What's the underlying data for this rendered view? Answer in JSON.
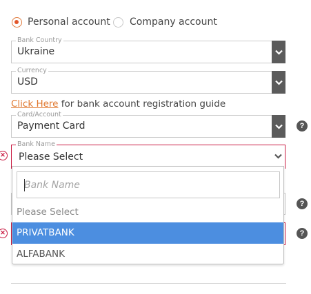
{
  "account_type": {
    "options": [
      {
        "label": "Personal account",
        "checked": true
      },
      {
        "label": "Company account",
        "checked": false
      }
    ]
  },
  "bank_country": {
    "label": "Bank Country",
    "value": "Ukraine"
  },
  "currency": {
    "label": "Currency",
    "value": "USD"
  },
  "guide": {
    "link_text": "Click Here",
    "rest": " for bank account registration guide"
  },
  "card_account": {
    "label": "Card/Account",
    "value": "Payment Card"
  },
  "bank_name": {
    "label": "Bank Name",
    "value": "Please Select",
    "search_placeholder": "Bank Name",
    "options": [
      "Please Select",
      "PRIVATBANK",
      "ALFABANK"
    ],
    "highlighted": "PRIVATBANK"
  },
  "help_symbol": "?",
  "error_symbol": "✕",
  "colors": {
    "accent": "#e2562b",
    "error": "#c8173f",
    "highlight": "#4c8ee0",
    "caret_bg": "#5b5b5b"
  }
}
